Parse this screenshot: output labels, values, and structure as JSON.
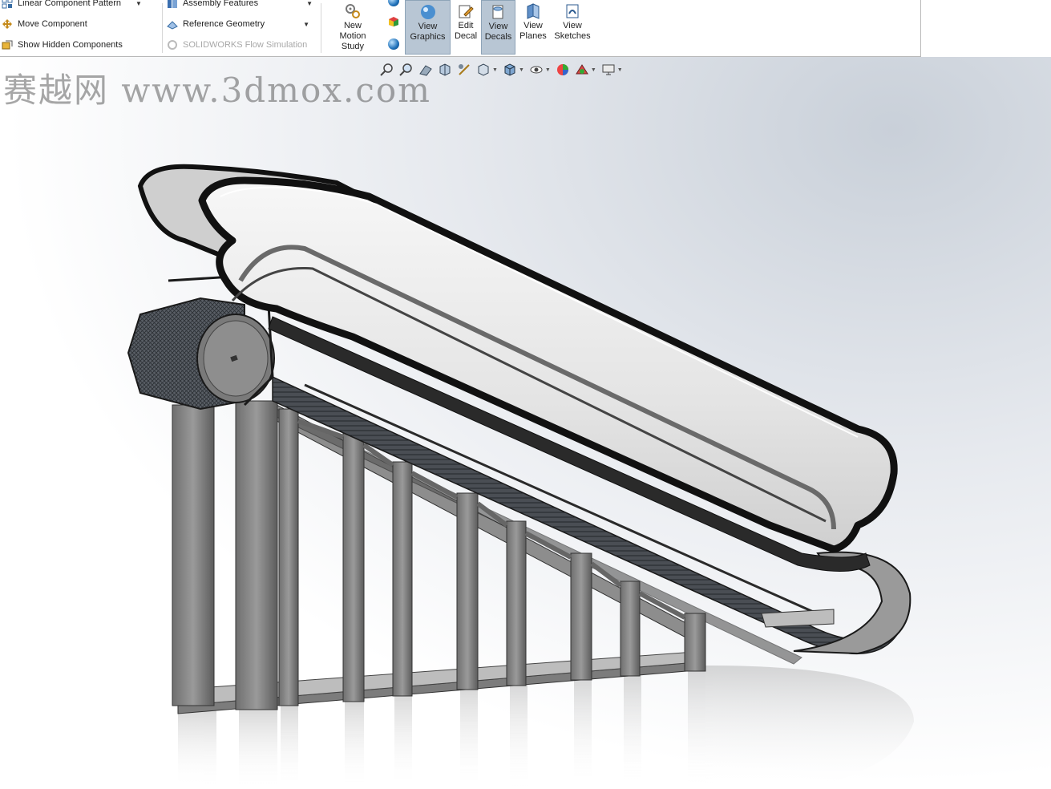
{
  "ribbon": {
    "left_group": [
      {
        "icon": "linear-pattern-icon",
        "label": "Linear Component Pattern",
        "has_caret": true
      },
      {
        "icon": "move-component-icon",
        "label": "Move Component",
        "has_caret": false
      },
      {
        "icon": "show-hidden-icon",
        "label": "Show Hidden Components",
        "has_caret": false
      }
    ],
    "mid_group": [
      {
        "icon": "assembly-features-icon",
        "label": "Assembly Features",
        "has_caret": true,
        "disabled": false
      },
      {
        "icon": "reference-geometry-icon",
        "label": "Reference Geometry",
        "has_caret": true,
        "disabled": false
      },
      {
        "icon": "flow-simulation-icon",
        "label": "SOLIDWORKS Flow Simulation",
        "has_caret": false,
        "disabled": true
      }
    ],
    "new_motion_study": {
      "line1": "New",
      "line2": "Motion",
      "line3": "Study"
    },
    "view_graphics": {
      "line1": "View",
      "line2": "Graphics"
    },
    "edit_decal": {
      "line1": "Edit",
      "line2": "Decal"
    },
    "view_decals": {
      "line1": "View",
      "line2": "Decals"
    },
    "view_planes": {
      "line1": "View",
      "line2": "Planes"
    },
    "view_sketches": {
      "line1": "View",
      "line2": "Sketches"
    }
  },
  "watermark": {
    "text": "赛越网 www.3dmox.com"
  },
  "hud": {
    "icons": [
      "zoom-to-fit-icon",
      "zoom-to-area-icon",
      "previous-view-icon",
      "section-view-icon",
      "dynamic-annotation-icon",
      "view-orientation-icon",
      "display-style-icon",
      "hide-show-items-icon",
      "edit-appearance-icon",
      "apply-scene-icon",
      "view-settings-icon"
    ]
  },
  "colors": {
    "ribbon_bg": "#ffffff",
    "active_button": "#b8c6d4",
    "frame_gray": "#8a8a8a",
    "dark_trim": "#1a1a1a",
    "glass": "#eeeeee"
  }
}
